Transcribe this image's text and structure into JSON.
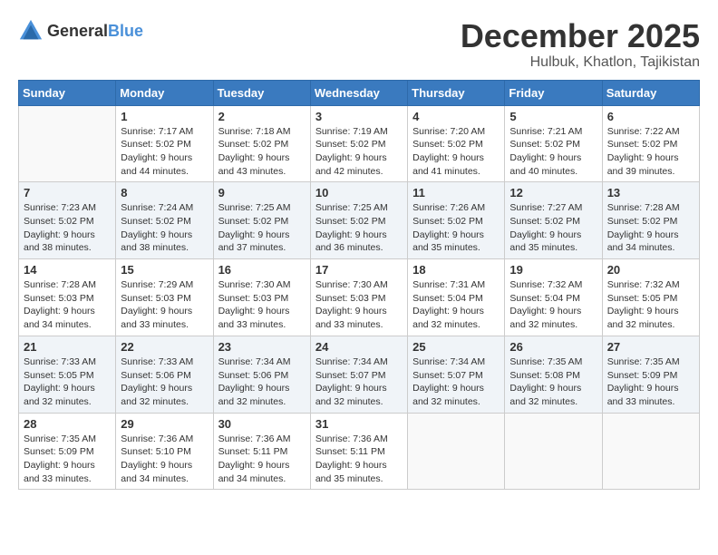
{
  "logo": {
    "general": "General",
    "blue": "Blue"
  },
  "header": {
    "month": "December 2025",
    "location": "Hulbuk, Khatlon, Tajikistan"
  },
  "weekdays": [
    "Sunday",
    "Monday",
    "Tuesday",
    "Wednesday",
    "Thursday",
    "Friday",
    "Saturday"
  ],
  "weeks": [
    [
      {
        "day": "",
        "sunrise": "",
        "sunset": "",
        "daylight": ""
      },
      {
        "day": "1",
        "sunrise": "Sunrise: 7:17 AM",
        "sunset": "Sunset: 5:02 PM",
        "daylight": "Daylight: 9 hours and 44 minutes."
      },
      {
        "day": "2",
        "sunrise": "Sunrise: 7:18 AM",
        "sunset": "Sunset: 5:02 PM",
        "daylight": "Daylight: 9 hours and 43 minutes."
      },
      {
        "day": "3",
        "sunrise": "Sunrise: 7:19 AM",
        "sunset": "Sunset: 5:02 PM",
        "daylight": "Daylight: 9 hours and 42 minutes."
      },
      {
        "day": "4",
        "sunrise": "Sunrise: 7:20 AM",
        "sunset": "Sunset: 5:02 PM",
        "daylight": "Daylight: 9 hours and 41 minutes."
      },
      {
        "day": "5",
        "sunrise": "Sunrise: 7:21 AM",
        "sunset": "Sunset: 5:02 PM",
        "daylight": "Daylight: 9 hours and 40 minutes."
      },
      {
        "day": "6",
        "sunrise": "Sunrise: 7:22 AM",
        "sunset": "Sunset: 5:02 PM",
        "daylight": "Daylight: 9 hours and 39 minutes."
      }
    ],
    [
      {
        "day": "7",
        "sunrise": "Sunrise: 7:23 AM",
        "sunset": "Sunset: 5:02 PM",
        "daylight": "Daylight: 9 hours and 38 minutes."
      },
      {
        "day": "8",
        "sunrise": "Sunrise: 7:24 AM",
        "sunset": "Sunset: 5:02 PM",
        "daylight": "Daylight: 9 hours and 38 minutes."
      },
      {
        "day": "9",
        "sunrise": "Sunrise: 7:25 AM",
        "sunset": "Sunset: 5:02 PM",
        "daylight": "Daylight: 9 hours and 37 minutes."
      },
      {
        "day": "10",
        "sunrise": "Sunrise: 7:25 AM",
        "sunset": "Sunset: 5:02 PM",
        "daylight": "Daylight: 9 hours and 36 minutes."
      },
      {
        "day": "11",
        "sunrise": "Sunrise: 7:26 AM",
        "sunset": "Sunset: 5:02 PM",
        "daylight": "Daylight: 9 hours and 35 minutes."
      },
      {
        "day": "12",
        "sunrise": "Sunrise: 7:27 AM",
        "sunset": "Sunset: 5:02 PM",
        "daylight": "Daylight: 9 hours and 35 minutes."
      },
      {
        "day": "13",
        "sunrise": "Sunrise: 7:28 AM",
        "sunset": "Sunset: 5:02 PM",
        "daylight": "Daylight: 9 hours and 34 minutes."
      }
    ],
    [
      {
        "day": "14",
        "sunrise": "Sunrise: 7:28 AM",
        "sunset": "Sunset: 5:03 PM",
        "daylight": "Daylight: 9 hours and 34 minutes."
      },
      {
        "day": "15",
        "sunrise": "Sunrise: 7:29 AM",
        "sunset": "Sunset: 5:03 PM",
        "daylight": "Daylight: 9 hours and 33 minutes."
      },
      {
        "day": "16",
        "sunrise": "Sunrise: 7:30 AM",
        "sunset": "Sunset: 5:03 PM",
        "daylight": "Daylight: 9 hours and 33 minutes."
      },
      {
        "day": "17",
        "sunrise": "Sunrise: 7:30 AM",
        "sunset": "Sunset: 5:03 PM",
        "daylight": "Daylight: 9 hours and 33 minutes."
      },
      {
        "day": "18",
        "sunrise": "Sunrise: 7:31 AM",
        "sunset": "Sunset: 5:04 PM",
        "daylight": "Daylight: 9 hours and 32 minutes."
      },
      {
        "day": "19",
        "sunrise": "Sunrise: 7:32 AM",
        "sunset": "Sunset: 5:04 PM",
        "daylight": "Daylight: 9 hours and 32 minutes."
      },
      {
        "day": "20",
        "sunrise": "Sunrise: 7:32 AM",
        "sunset": "Sunset: 5:05 PM",
        "daylight": "Daylight: 9 hours and 32 minutes."
      }
    ],
    [
      {
        "day": "21",
        "sunrise": "Sunrise: 7:33 AM",
        "sunset": "Sunset: 5:05 PM",
        "daylight": "Daylight: 9 hours and 32 minutes."
      },
      {
        "day": "22",
        "sunrise": "Sunrise: 7:33 AM",
        "sunset": "Sunset: 5:06 PM",
        "daylight": "Daylight: 9 hours and 32 minutes."
      },
      {
        "day": "23",
        "sunrise": "Sunrise: 7:34 AM",
        "sunset": "Sunset: 5:06 PM",
        "daylight": "Daylight: 9 hours and 32 minutes."
      },
      {
        "day": "24",
        "sunrise": "Sunrise: 7:34 AM",
        "sunset": "Sunset: 5:07 PM",
        "daylight": "Daylight: 9 hours and 32 minutes."
      },
      {
        "day": "25",
        "sunrise": "Sunrise: 7:34 AM",
        "sunset": "Sunset: 5:07 PM",
        "daylight": "Daylight: 9 hours and 32 minutes."
      },
      {
        "day": "26",
        "sunrise": "Sunrise: 7:35 AM",
        "sunset": "Sunset: 5:08 PM",
        "daylight": "Daylight: 9 hours and 32 minutes."
      },
      {
        "day": "27",
        "sunrise": "Sunrise: 7:35 AM",
        "sunset": "Sunset: 5:09 PM",
        "daylight": "Daylight: 9 hours and 33 minutes."
      }
    ],
    [
      {
        "day": "28",
        "sunrise": "Sunrise: 7:35 AM",
        "sunset": "Sunset: 5:09 PM",
        "daylight": "Daylight: 9 hours and 33 minutes."
      },
      {
        "day": "29",
        "sunrise": "Sunrise: 7:36 AM",
        "sunset": "Sunset: 5:10 PM",
        "daylight": "Daylight: 9 hours and 34 minutes."
      },
      {
        "day": "30",
        "sunrise": "Sunrise: 7:36 AM",
        "sunset": "Sunset: 5:11 PM",
        "daylight": "Daylight: 9 hours and 34 minutes."
      },
      {
        "day": "31",
        "sunrise": "Sunrise: 7:36 AM",
        "sunset": "Sunset: 5:11 PM",
        "daylight": "Daylight: 9 hours and 35 minutes."
      },
      {
        "day": "",
        "sunrise": "",
        "sunset": "",
        "daylight": ""
      },
      {
        "day": "",
        "sunrise": "",
        "sunset": "",
        "daylight": ""
      },
      {
        "day": "",
        "sunrise": "",
        "sunset": "",
        "daylight": ""
      }
    ]
  ]
}
